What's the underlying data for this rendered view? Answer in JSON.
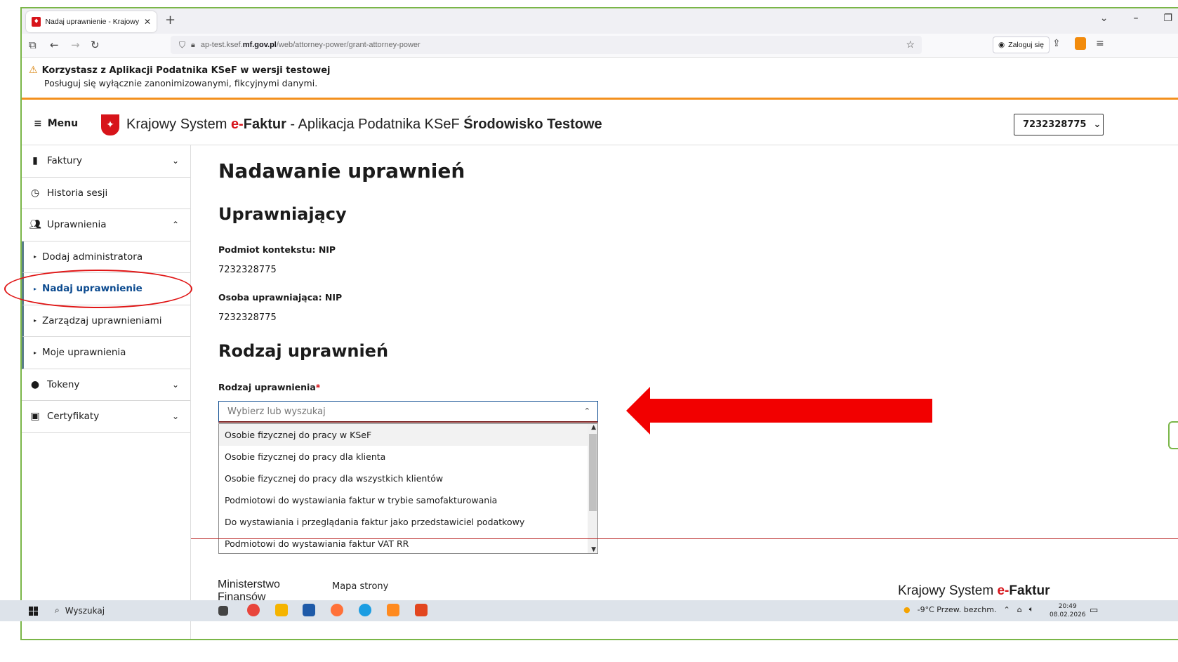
{
  "browser": {
    "tab_title": "Nadaj uprawnienie - Krajowy Sy",
    "url_prefix": "ap-test.ksef.",
    "url_domain": "mf.gov.pl",
    "url_path": "/web/attorney-power/grant-attorney-power",
    "login_label": "Zaloguj się"
  },
  "banner": {
    "title": "Korzystasz z Aplikacji Podatnika KSeF w wersji testowej",
    "text": "Posługuj się wyłącznie zanonimizowanymi, fikcyjnymi danymi."
  },
  "header": {
    "menu_label": "Menu",
    "brand_prefix": "Krajowy System ",
    "brand_e": "e-",
    "brand_faktur": "Faktur",
    "brand_suffix": " - Aplikacja Podatnika KSeF ",
    "brand_env": "Środowisko Testowe",
    "nip_selected": "7232328775"
  },
  "sidebar": {
    "items": [
      {
        "label": "Faktury",
        "icon": "file-icon"
      },
      {
        "label": "Historia sesji",
        "icon": "clock-icon"
      },
      {
        "label": "Uprawnienia",
        "icon": "users-icon"
      }
    ],
    "sub_items": [
      {
        "label": "Dodaj administratora"
      },
      {
        "label": "Nadaj uprawnienie"
      },
      {
        "label": "Zarządzaj uprawnieniami"
      },
      {
        "label": "Moje uprawnienia"
      }
    ],
    "bottom_items": [
      {
        "label": "Tokeny",
        "icon": "token-icon"
      },
      {
        "label": "Certyfikaty",
        "icon": "certificate-icon"
      }
    ]
  },
  "main": {
    "title": "Nadawanie uprawnień",
    "section_grantor": "Uprawniający",
    "context_label": "Podmiot kontekstu: NIP",
    "context_value": "7232328775",
    "grantor_label": "Osoba uprawniająca: NIP",
    "grantor_value": "7232328775",
    "section_type": "Rodzaj uprawnień",
    "type_label": "Rodzaj uprawnienia",
    "required_mark": "*",
    "combo_placeholder": "Wybierz lub wyszukaj",
    "options": [
      "Osobie fizycznej do pracy w KSeF",
      "Osobie fizycznej do pracy dla klienta",
      "Osobie fizycznej do pracy dla wszystkich klientów",
      "Podmiotowi do wystawiania faktur w trybie samofakturowania",
      "Do wystawiania i przeglądania faktur jako przedstawiciel podatkowy",
      "Podmiotowi do wystawiania faktur VAT RR"
    ]
  },
  "footer": {
    "ministry": "Ministerstwo",
    "ministry_cut": "Finansów",
    "sitemap": "Mapa strony",
    "brand_prefix": "Krajowy System ",
    "brand_e": "e-",
    "brand_faktur": "Faktur"
  },
  "taskbar": {
    "search": "Wyszukaj",
    "weather": "-9°C  Przew. bezchm.",
    "time": "20:49",
    "date": "08.02.2026"
  },
  "colors": {
    "accent_red": "#d7141a",
    "banner_orange": "#f3901d",
    "active_blue": "#0b4a8f"
  }
}
